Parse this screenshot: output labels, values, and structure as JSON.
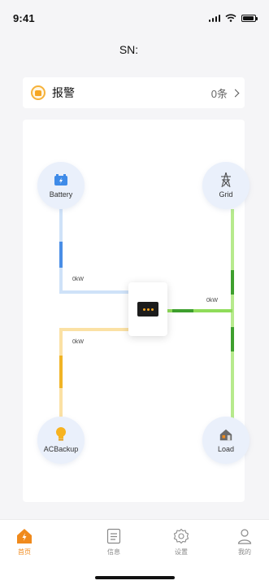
{
  "status_bar": {
    "time": "9:41"
  },
  "header": {
    "sn_label": "SN:",
    "sn_value": ""
  },
  "alarm": {
    "title": "报警",
    "count": "0条"
  },
  "flow": {
    "battery": {
      "label": "Battery",
      "power": "0kW"
    },
    "grid": {
      "label": "Grid",
      "power": "0kW"
    },
    "acbackup": {
      "label": "ACBackup",
      "power": "0kW"
    },
    "load": {
      "label": "Load"
    },
    "colors": {
      "battery": "#7ab5f2",
      "acbackup": "#f4c04a",
      "grid": "#8fdc5a",
      "grid_dark": "#3e9f2e"
    }
  },
  "tabs": [
    {
      "label": "首页",
      "icon": "home-icon",
      "active": true
    },
    {
      "label": "信息",
      "icon": "info-list-icon",
      "active": false
    },
    {
      "label": "设置",
      "icon": "settings-icon",
      "active": false
    },
    {
      "label": "我的",
      "icon": "profile-icon",
      "active": false
    }
  ],
  "accent_color": "#f08a1c"
}
